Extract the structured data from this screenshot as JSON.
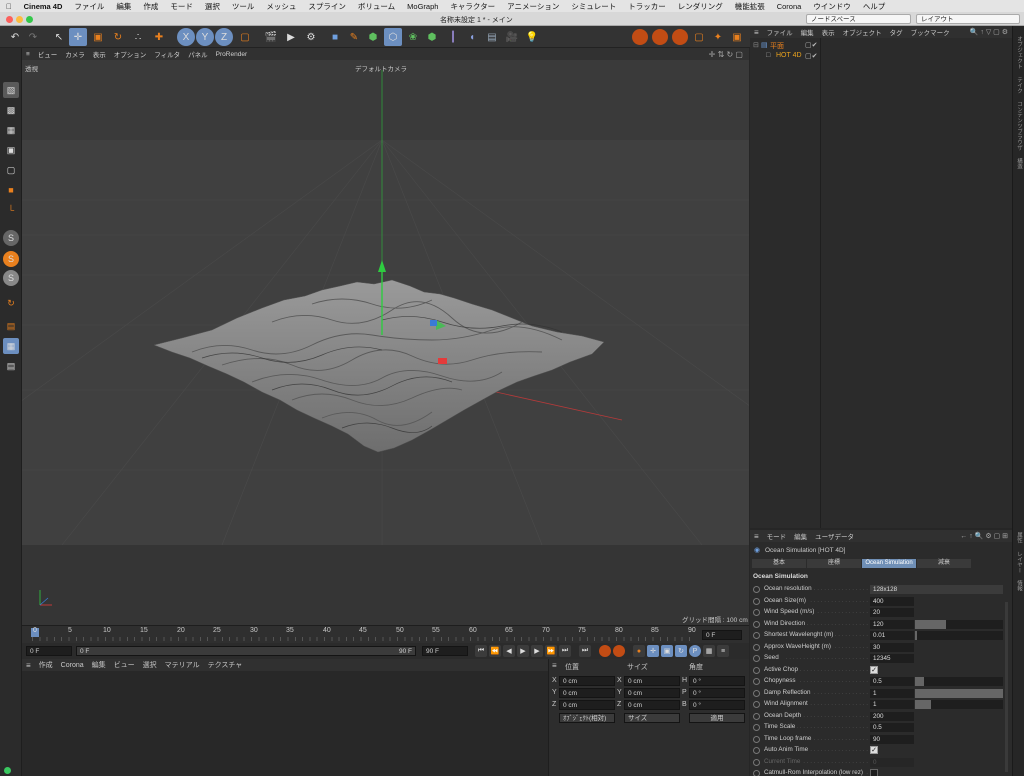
{
  "menubar": {
    "apple": "",
    "items": [
      "Cinema 4D",
      "ファイル",
      "編集",
      "作成",
      "モード",
      "選択",
      "ツール",
      "メッシュ",
      "スプライン",
      "ボリューム",
      "MoGraph",
      "キャラクター",
      "アニメーション",
      "シミュレート",
      "トラッカー",
      "レンダリング",
      "機能拡張",
      "Corona",
      "ウインドウ",
      "ヘルプ"
    ]
  },
  "titlebar": {
    "title": "名称未設定 1 * - メイン",
    "nodespace": "ノードスペース",
    "layout": "レイアウト"
  },
  "viewport": {
    "menu": [
      "ビュー",
      "カメラ",
      "表示",
      "オプション",
      "フィルタ",
      "パネル",
      "ProRender"
    ],
    "mode": "透視",
    "camera": "デフォルトカメラ",
    "grid_info": "グリッド間隔 : 100 cm",
    "colors": {
      "bg": "#3a3a3a",
      "mesh": "#8a8a8a",
      "y_axis": "#2ecc40",
      "x_axis": "#e43b3b",
      "z_axis": "#3a7bd5"
    }
  },
  "timeline": {
    "ticks": [
      "0",
      "5",
      "10",
      "15",
      "20",
      "25",
      "30",
      "35",
      "40",
      "45",
      "50",
      "55",
      "60",
      "65",
      "70",
      "75",
      "80",
      "85",
      "90"
    ],
    "current": "0 F"
  },
  "transport": {
    "start": "0 F",
    "preview_start": "0 F",
    "preview_end": "90 F",
    "end": "90 F"
  },
  "material": {
    "menu": [
      "作成",
      "Corona",
      "編集",
      "ビュー",
      "選択",
      "マテリアル",
      "テクスチャ"
    ]
  },
  "coords": {
    "headers": {
      "pos": "位置",
      "size": "サイズ",
      "rot": "角度"
    },
    "rows": [
      {
        "pl": "X",
        "pv": "0 cm",
        "sl": "X",
        "sv": "0 cm",
        "rl": "H",
        "rv": "0 °"
      },
      {
        "pl": "Y",
        "pv": "0 cm",
        "sl": "Y",
        "sv": "0 cm",
        "rl": "P",
        "rv": "0 °"
      },
      {
        "pl": "Z",
        "pv": "0 cm",
        "sl": "Z",
        "sv": "0 cm",
        "rl": "B",
        "rv": "0 °"
      }
    ],
    "mode_select": "ｵﾌﾞｼﾞｪｸﾄ(相対)",
    "size_select": "サイズ",
    "apply": "適用"
  },
  "objects": {
    "menu": [
      "ファイル",
      "編集",
      "表示",
      "オブジェクト",
      "タグ",
      "ブックマーク"
    ],
    "items": [
      {
        "name": "平面",
        "color": "#e9801e"
      },
      {
        "name": "HOT 4D",
        "color": "#e9a21e"
      }
    ]
  },
  "rightstrip": [
    "オブジェクト",
    "テイク",
    "コンテンツブラウザ",
    "構造",
    "属性",
    "レイヤー",
    "情報"
  ],
  "attributes": {
    "menu": [
      "モード",
      "編集",
      "ユーザデータ"
    ],
    "object_title": "Ocean Simulation [HOT 4D]",
    "tabs": [
      "基本",
      "座標",
      "Ocean Simulation",
      "減衰"
    ],
    "active_tab": 2,
    "section": "Ocean Simulation",
    "params": [
      {
        "label": "Ocean resolution",
        "value": "128x128",
        "kind": "dropdown"
      },
      {
        "label": "Ocean Size(m)",
        "value": "400",
        "kind": "num"
      },
      {
        "label": "Wind Speed (m/s)",
        "value": "20",
        "kind": "num"
      },
      {
        "label": "Wind Direction",
        "value": "120",
        "kind": "slider",
        "fill": 0.35
      },
      {
        "label": "Shortest Wavelenght (m)",
        "value": "0.01",
        "kind": "slider",
        "fill": 0.0
      },
      {
        "label": "Approx WaveHeight (m)",
        "value": "30",
        "kind": "num"
      },
      {
        "label": "Seed",
        "value": "12345",
        "kind": "num"
      },
      {
        "label": "Active Chop",
        "value": "✓",
        "kind": "check"
      },
      {
        "label": "Chopyness",
        "value": "0.5",
        "kind": "slider",
        "fill": 0.1
      },
      {
        "label": "Damp Reflection",
        "value": "1",
        "kind": "slider",
        "fill": 1.0
      },
      {
        "label": "Wind Alignment",
        "value": "1",
        "kind": "slider",
        "fill": 0.18
      },
      {
        "label": "Ocean Depth",
        "value": "200",
        "kind": "num"
      },
      {
        "label": "Time Scale",
        "value": "0.5",
        "kind": "num"
      },
      {
        "label": "Time Loop frame",
        "value": "90",
        "kind": "num"
      },
      {
        "label": "Auto Anim Time",
        "value": "✓",
        "kind": "check"
      },
      {
        "label": "Current Time",
        "value": "0",
        "kind": "disabled"
      },
      {
        "label": "Catmull-Rom Interpolation (low rez)",
        "value": "",
        "kind": "check-empty"
      }
    ]
  }
}
